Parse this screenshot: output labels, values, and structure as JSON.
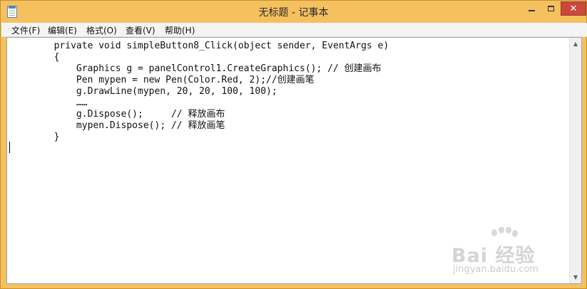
{
  "window": {
    "title": "无标题 - 记事本",
    "close_glyph": "✕"
  },
  "menu": {
    "items": [
      {
        "label": "文件(F)"
      },
      {
        "label": "编辑(E)"
      },
      {
        "label": "格式(O)"
      },
      {
        "label": "查看(V)"
      },
      {
        "label": "帮助(H)"
      }
    ]
  },
  "editor": {
    "lines": [
      "        private void simpleButton8_Click(object sender, EventArgs e)",
      "        {",
      "            Graphics g = panelControl1.CreateGraphics(); // 创建画布",
      "            Pen mypen = new Pen(Color.Red, 2);//创建画笔",
      "            g.DrawLine(mypen, 20, 20, 100, 100);",
      "            ……",
      "            g.Dispose();     // 释放画布",
      "            mypen.Dispose(); // 释放画笔",
      "        }"
    ]
  },
  "scrollbar": {
    "up_glyph": "▲",
    "down_glyph": "▼"
  },
  "watermark": {
    "brand": "Bai 经验",
    "url": "jingyan.baidu.com"
  },
  "colors": {
    "title_bar": "#f5c15f",
    "close_button": "#c9493f",
    "menu_bar": "#f4f4f4",
    "editor_bg": "#ffffff"
  }
}
